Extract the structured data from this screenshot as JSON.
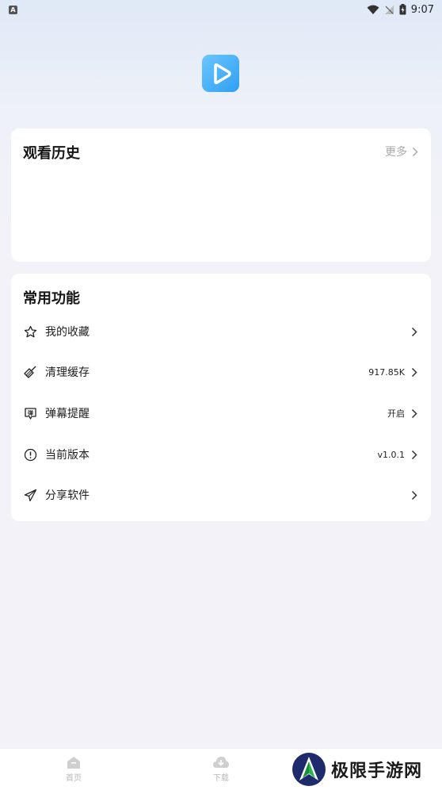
{
  "status_bar": {
    "app_indicator": "A",
    "time": "9:07"
  },
  "history": {
    "title": "观看历史",
    "more_label": "更多"
  },
  "functions": {
    "title": "常用功能",
    "items": [
      {
        "label": "我的收藏",
        "value": "",
        "icon": "star-icon"
      },
      {
        "label": "清理缓存",
        "value": "917.85K",
        "icon": "broom-icon"
      },
      {
        "label": "弹幕提醒",
        "value": "开启",
        "icon": "danmaku-icon"
      },
      {
        "label": "当前版本",
        "value": "v1.0.1",
        "icon": "info-circle-icon"
      },
      {
        "label": "分享软件",
        "value": "",
        "icon": "paper-plane-icon"
      }
    ]
  },
  "bottom_nav": {
    "tabs": [
      {
        "label": "首页",
        "icon": "home-icon"
      },
      {
        "label": "下载",
        "icon": "download-cloud-icon"
      }
    ]
  },
  "watermark": {
    "text": "极限手游网"
  },
  "colors": {
    "accent": "#2f9ff2",
    "card_bg": "#ffffff",
    "page_bg": "#f2f2f8",
    "muted_text": "#a9a9a9"
  }
}
